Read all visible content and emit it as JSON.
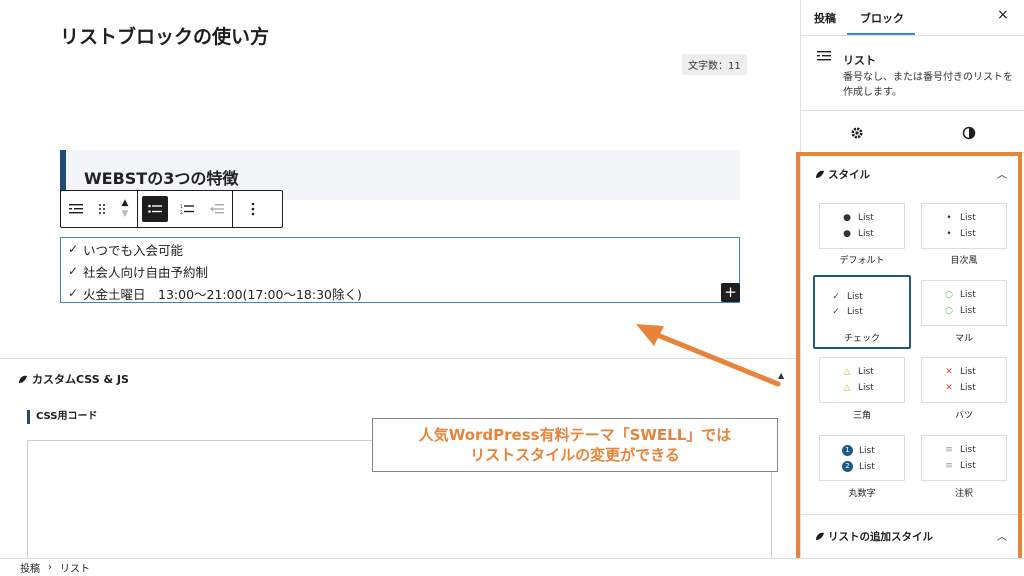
{
  "editor": {
    "post_title": "リストブロックの使い方",
    "char_count": "文字数：11",
    "heading": "WEBSTの3つの特徴",
    "list_items": [
      "いつでも入会可能",
      "社会人向け自由予約制",
      "火金土曜日　13:00〜21:00(17:00〜18:30除く)"
    ],
    "add_block_glyph": "+"
  },
  "meta_box": {
    "title": "カスタムCSS & JS",
    "css_label": "CSS用コード"
  },
  "callout": {
    "line1": "人気WordPress有料テーマ「SWELL」では",
    "line2": "リストスタイルの変更ができる"
  },
  "breadcrumb": {
    "items": [
      "投稿",
      "リスト"
    ],
    "separator": "›"
  },
  "sidebar": {
    "tabs": [
      "投稿",
      "ブロック"
    ],
    "close_glyph": "×",
    "block_name": "リスト",
    "block_desc": "番号なし、または番号付きのリストを作成します。",
    "style_panel_title": "スタイル",
    "additional_panel_title": "リストの追加スタイル",
    "sample_text": "List",
    "styles": [
      {
        "label": "デフォルト",
        "marker": "•"
      },
      {
        "label": "目次風",
        "marker": "·"
      },
      {
        "label": "チェック",
        "marker": "✓"
      },
      {
        "label": "マル",
        "marker": "○"
      },
      {
        "label": "三角",
        "marker": "△"
      },
      {
        "label": "バツ",
        "marker": "✕"
      },
      {
        "label": "丸数字",
        "marker": "num"
      },
      {
        "label": "注釈",
        "marker": "≡"
      }
    ],
    "selected_style": "チェック"
  },
  "colors": {
    "accent_orange": "#e8833a",
    "selected_blue": "#1f5a85",
    "check_green": "#5cb85c",
    "cross_red": "#e05050",
    "triangle_yellow": "#e0b030"
  }
}
